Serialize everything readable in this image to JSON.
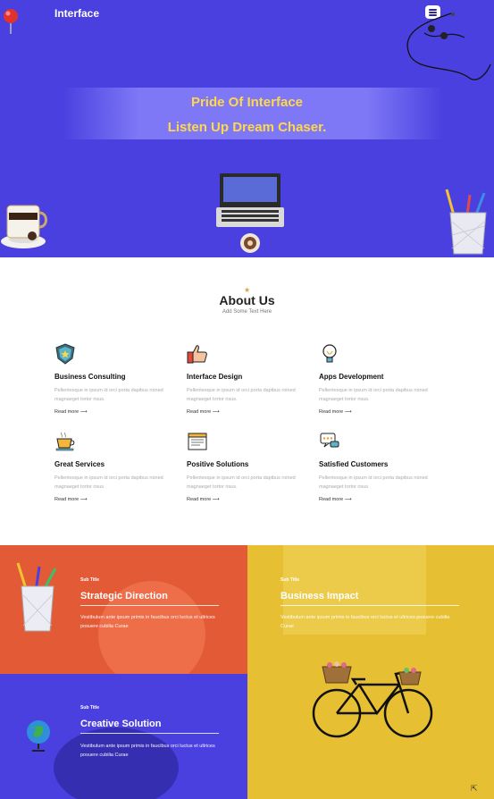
{
  "header": {
    "brand": "Interface"
  },
  "hero": {
    "line1": "Pride Of Interface",
    "line2": "Listen Up Dream Chaser."
  },
  "about": {
    "title": "About Us",
    "subtitle": "Add Some Text Here"
  },
  "services": [
    {
      "title": "Business Consulting",
      "text": "Pellentesque in ipsum id orci porta dapibus roined magnaeget tortor risus.",
      "more": "Read more",
      "icon": "shield-icon"
    },
    {
      "title": "Interface Design",
      "text": "Pellentesque in ipsum id orci porta dapibus roined magnaeget tortor risus.",
      "more": "Read more",
      "icon": "thumbs-up-icon"
    },
    {
      "title": "Apps Development",
      "text": "Pellentesque in ipsum id orci porta dapibus roined magnaeget tortor risus.",
      "more": "Read more",
      "icon": "lightbulb-icon"
    },
    {
      "title": "Great Services",
      "text": "Pellentesque in ipsum id orci porta dapibus roined magnaeget tortor risus.",
      "more": "Read more",
      "icon": "coffee-cup-icon"
    },
    {
      "title": "Positive Solutions",
      "text": "Pellentesque in ipsum id orci porta dapibus roined magnaeget tortor risus.",
      "more": "Read more",
      "icon": "document-icon"
    },
    {
      "title": "Satisfied Customers",
      "text": "Pellentesque in ipsum id orci porta dapibus roined magnaeget tortor risus.",
      "more": "Read more",
      "icon": "chat-bubble-icon"
    }
  ],
  "features": [
    {
      "kicker": "Sub Title",
      "title": "Strategic Direction",
      "text": "Vestibulum ante ipsum primis in faucibus orci luctus et ultrices posuere cubilia Curae"
    },
    {
      "kicker": "Sub Title",
      "title": "Business Impact",
      "text": "Vestibulum ante ipsum primis in faucibus orci luctus et ultrices posuere cubilia Curae"
    },
    {
      "kicker": "Sub Title",
      "title": "Creative Solution",
      "text": "Vestibulum ante ipsum primis in faucibus orci luctus et ultrices posuere cubilia Curae"
    }
  ],
  "colors": {
    "hero": "#4a40e0",
    "accent_yellow": "#ffd84a",
    "orange": "#e35a36",
    "yellow": "#e6c032",
    "blue": "#4a40e0"
  }
}
